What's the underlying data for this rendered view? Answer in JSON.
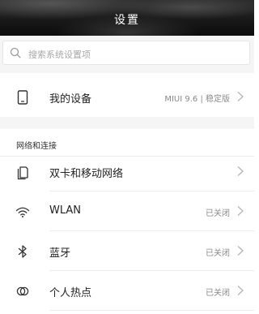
{
  "header": {
    "title": "设置"
  },
  "search": {
    "placeholder": "搜索系统设置项"
  },
  "device": {
    "label": "我的设备",
    "value": "MIUI 9.6 | 稳定版"
  },
  "network_section": {
    "title": "网络和连接",
    "items": [
      {
        "label": "双卡和移动网络",
        "value": ""
      },
      {
        "label": "WLAN",
        "value": "已关闭"
      },
      {
        "label": "蓝牙",
        "value": "已关闭"
      },
      {
        "label": "个人热点",
        "value": "已关闭"
      }
    ]
  },
  "colors": {
    "accent_dark": "#111111",
    "background_gray": "#f5f5f5",
    "text_secondary": "#8a8a8a"
  }
}
